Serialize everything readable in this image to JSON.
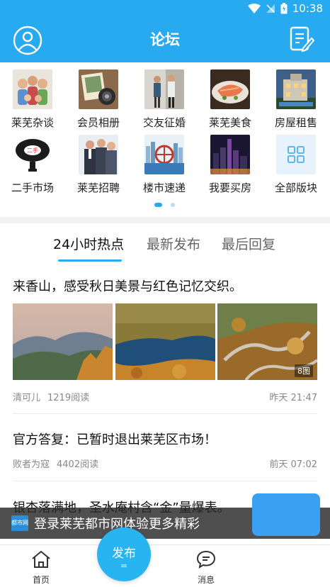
{
  "status_bar": {
    "time": "10:38"
  },
  "header": {
    "title": "论坛"
  },
  "categories": [
    {
      "label": "莱芜杂谈",
      "icon": "family-photo-icon"
    },
    {
      "label": "会员相册",
      "icon": "camera-photo-icon"
    },
    {
      "label": "交友征婚",
      "icon": "couple-photo-icon"
    },
    {
      "label": "莱芜美食",
      "icon": "food-photo-icon"
    },
    {
      "label": "房屋租售",
      "icon": "house-photo-icon"
    },
    {
      "label": "二手市场",
      "icon": "piggybank-icon"
    },
    {
      "label": "莱芜招聘",
      "icon": "business-people-icon"
    },
    {
      "label": "楼市速递",
      "icon": "city-wheel-icon"
    },
    {
      "label": "我要买房",
      "icon": "night-city-icon"
    },
    {
      "label": "全部版块",
      "icon": "grid-icon"
    }
  ],
  "tabs": [
    {
      "label": "24小时热点",
      "active": true
    },
    {
      "label": "最新发布",
      "active": false
    },
    {
      "label": "最后回复",
      "active": false
    }
  ],
  "posts": [
    {
      "title": "来香山，感受秋日美景与红色记忆交织。",
      "author": "清可儿",
      "reads": "1219阅读",
      "time": "昨天 21:47",
      "image_count": "8图"
    },
    {
      "title": "官方答复：已暂时退出莱芜区市场！",
      "author": "败者为寇",
      "reads": "4402阅读",
      "time": "前天 07:02"
    },
    {
      "title": "银杏落满地，圣水庵村含“金”量爆表。"
    }
  ],
  "banner": {
    "logo_text": "都市网",
    "text": "登录莱芜都市网体验更多精彩"
  },
  "bottom_nav": {
    "home": "首页",
    "publish": "发布",
    "publish_sub": "=",
    "messages": "消息"
  },
  "colors": {
    "brand": "#28aaf0",
    "accent": "#28b4f0"
  }
}
